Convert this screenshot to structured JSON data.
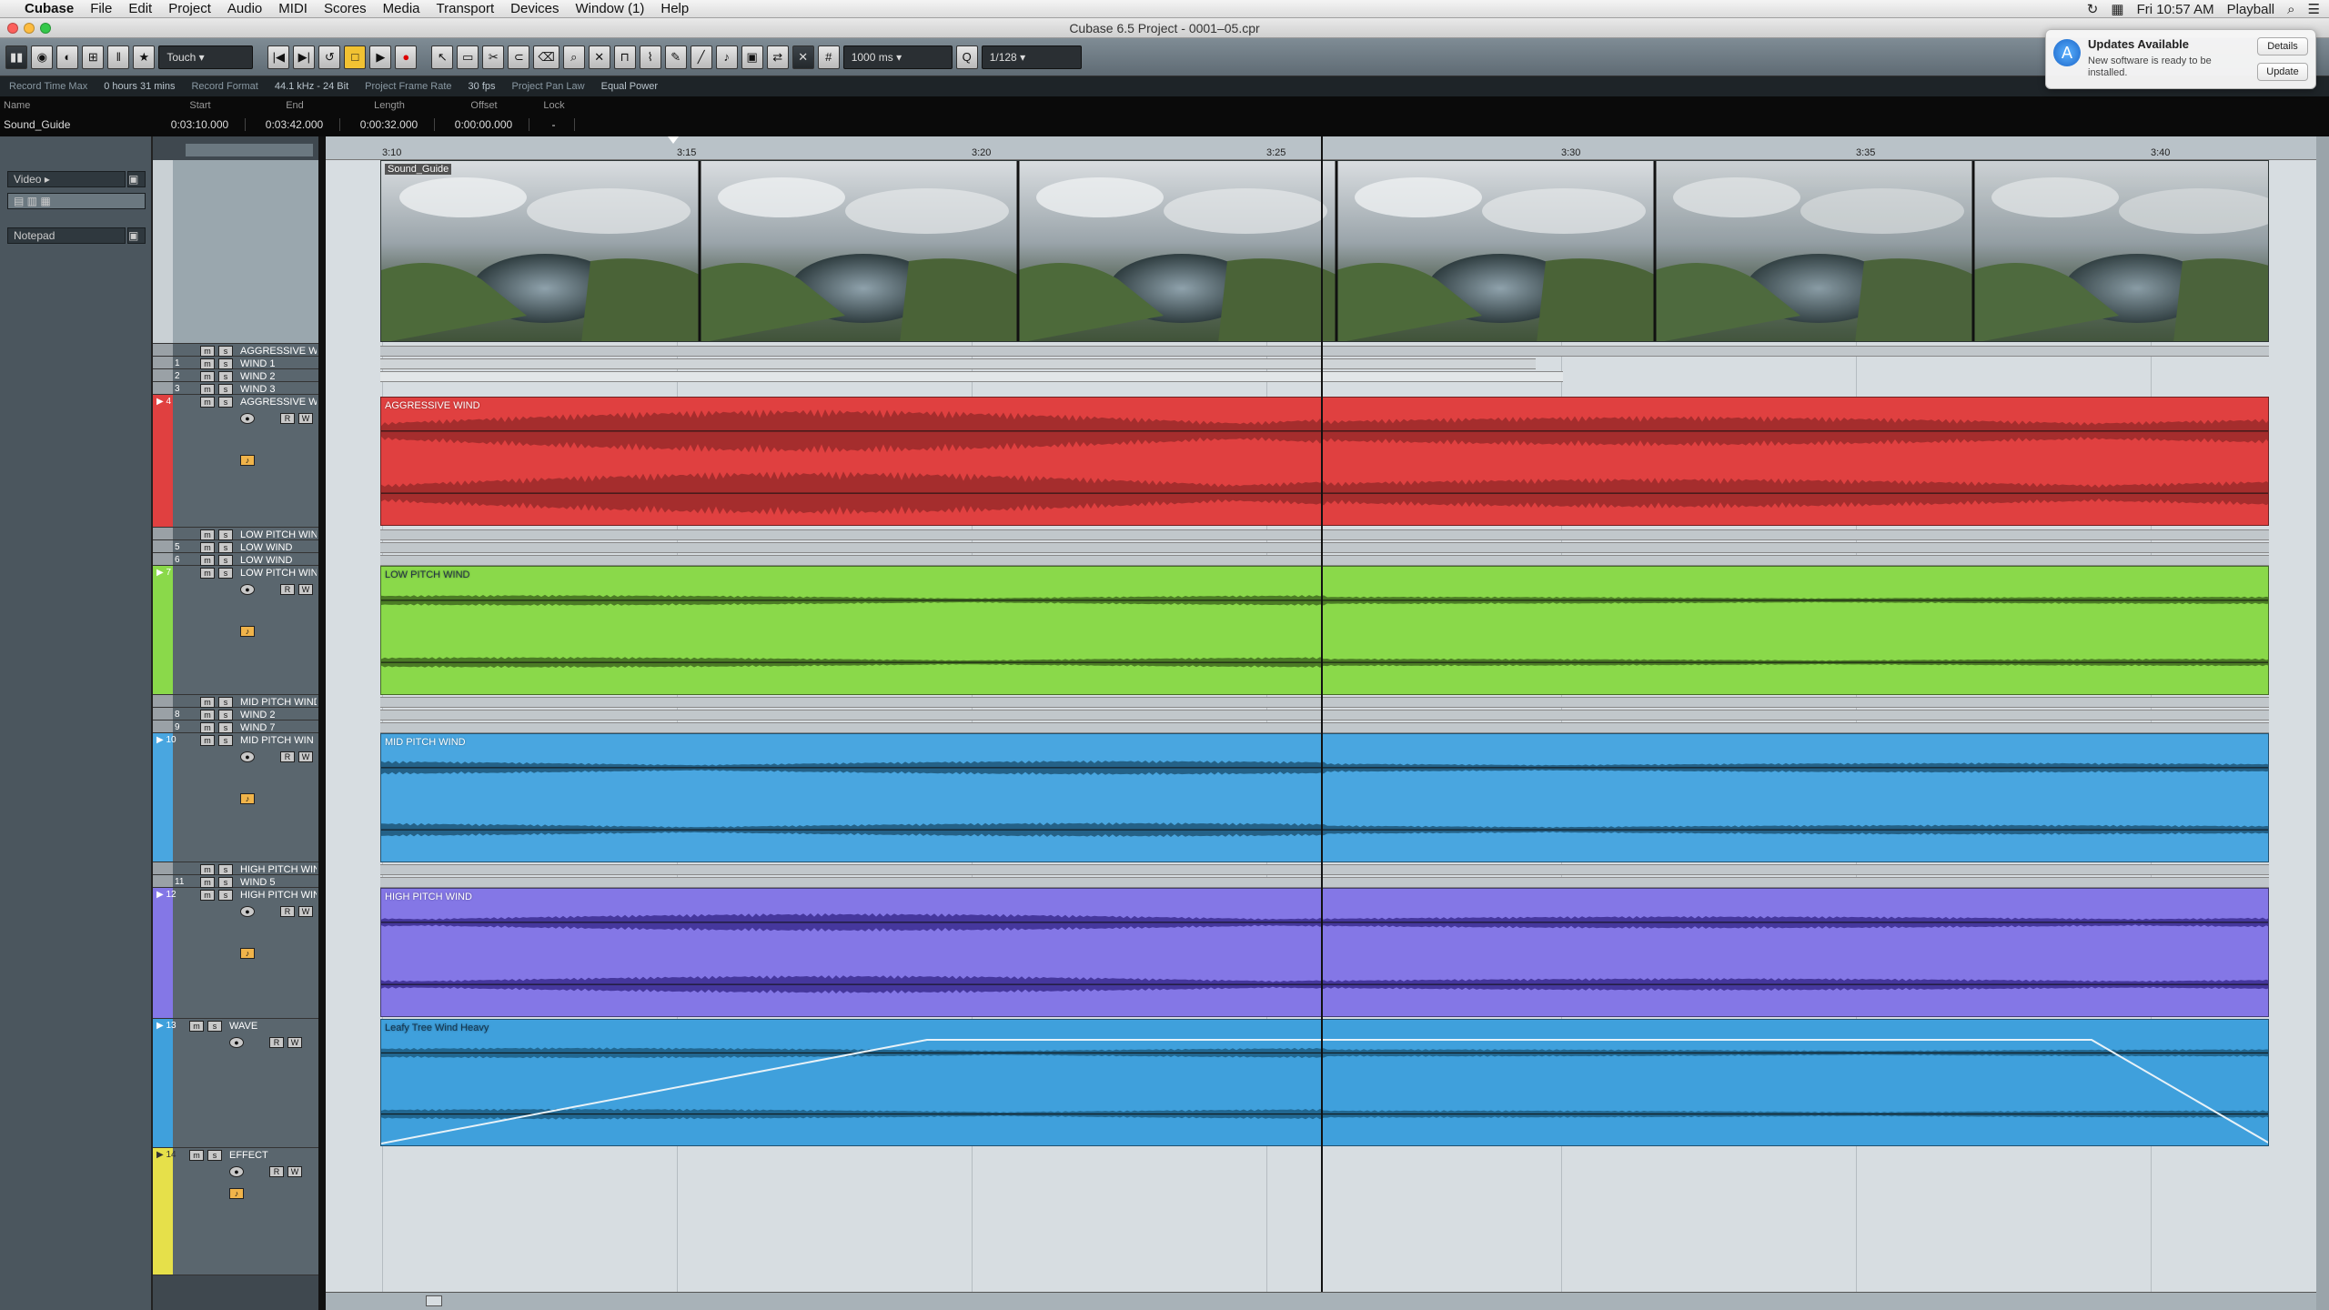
{
  "menubar": {
    "app": "Cubase",
    "items": [
      "File",
      "Edit",
      "Project",
      "Audio",
      "MIDI",
      "Scores",
      "Media",
      "Transport",
      "Devices",
      "Window (1)",
      "Help"
    ],
    "clock": "Fri 10:57 AM",
    "user": "Playball"
  },
  "window": {
    "title": "Cubase 6.5 Project - 0001–05.cpr"
  },
  "toolbar": {
    "automation_mode": "Touch",
    "snap_value": "1000 ms",
    "quantize": "1/128"
  },
  "infoline": {
    "record_time_max_label": "Record Time Max",
    "record_time_max": "0 hours 31 mins",
    "record_format_label": "Record Format",
    "record_format": "44.1 kHz - 24 Bit",
    "frame_rate_label": "Project Frame Rate",
    "frame_rate": "30 fps",
    "pan_law_label": "Project Pan Law",
    "pan_law": "Equal Power"
  },
  "event_info": {
    "name_label": "Name",
    "name": "Sound_Guide",
    "start_label": "Start",
    "start": "0:03:10.000",
    "end_label": "End",
    "end": "0:03:42.000",
    "length_label": "Length",
    "length": "0:00:32.000",
    "offset_label": "Offset",
    "offset": "0:00:00.000",
    "lock_label": "Lock",
    "lock": "-"
  },
  "inspector": {
    "video_label": "Video",
    "notepad_label": "Notepad"
  },
  "ruler": {
    "ticks": [
      "3:10",
      "3:15",
      "3:20",
      "3:25",
      "3:30",
      "3:35",
      "3:40"
    ]
  },
  "tracks": {
    "video_event": "Sound_Guide",
    "folder_aggressive": "AGGRESSIVE WIN",
    "wind1": "WIND 1",
    "wind2": "WIND 2",
    "wind3": "WIND 3",
    "aggressive": "AGGRESSIVE WIN",
    "aggressive_event": "AGGRESSIVE WIND",
    "folder_low": "LOW PITCH WIN",
    "low_a": "LOW WIND",
    "low_b": "LOW WIND",
    "low": "LOW PITCH WIN",
    "low_event": "LOW PITCH WIND",
    "folder_mid": "MID PITCH WIND",
    "mid_a": "WIND 2",
    "mid_b": "WIND 7",
    "mid": "MID PITCH WIN",
    "mid_event": "MID PITCH WIND",
    "folder_high": "HIGH PITCH WIN",
    "high_a": "WIND 5",
    "high": "HIGH PITCH WIN",
    "high_event": "HIGH PITCH WIND",
    "wave": "WAVE",
    "wave_event": "Leafy Tree Wind Heavy",
    "effect": "EFFECT"
  },
  "notification": {
    "title": "Updates Available",
    "body": "New software is ready to be installed.",
    "details": "Details",
    "update": "Update"
  },
  "colors": {
    "aggressive": "#e04040",
    "low": "#8ad94a",
    "mid": "#49a6e0",
    "high": "#8477e6",
    "wave": "#3fa0dc",
    "effect": "#e6e04a"
  }
}
